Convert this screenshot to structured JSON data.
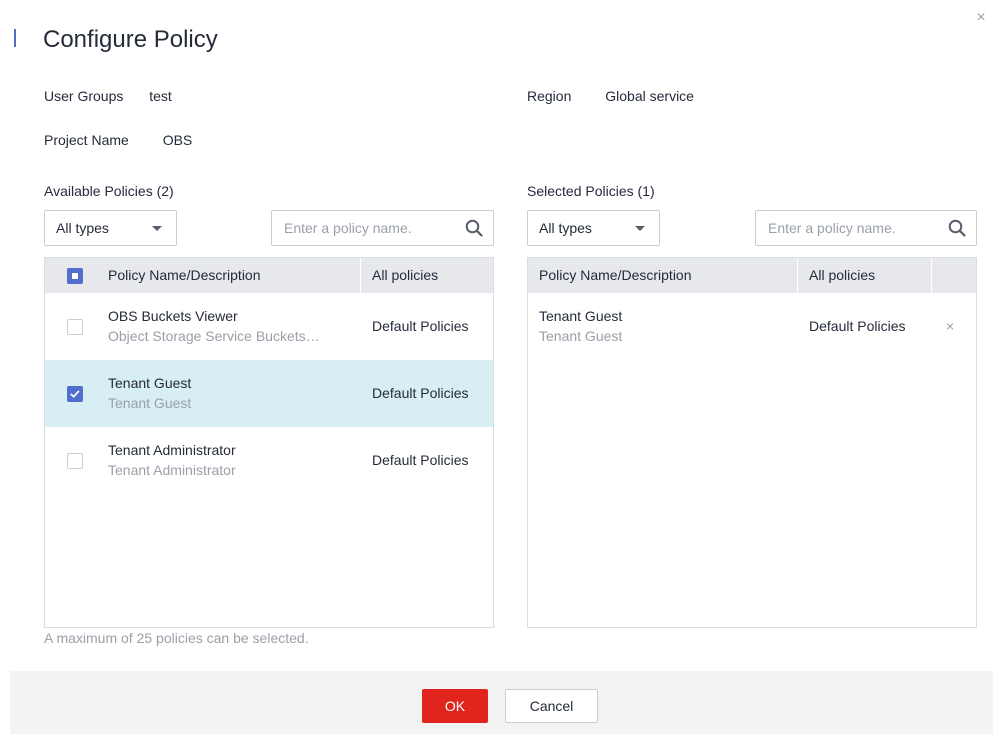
{
  "dialog": {
    "title": "Configure Policy",
    "close_glyph": "×"
  },
  "info": {
    "user_groups_label": "User Groups",
    "user_groups_value": "test",
    "region_label": "Region",
    "region_value": "Global service",
    "project_label": "Project Name",
    "project_value": "OBS"
  },
  "available": {
    "title": "Available Policies (2)",
    "filter": {
      "selected": "All types"
    },
    "search": {
      "placeholder": "Enter a policy name."
    },
    "header": {
      "col_name": "Policy Name/Description",
      "col_type": "All policies",
      "select_all_state": "partial"
    },
    "rows": [
      {
        "name": "OBS Buckets Viewer",
        "desc": "Object Storage Service Buckets…",
        "type": "Default Policies",
        "checked": false
      },
      {
        "name": "Tenant Guest",
        "desc": "Tenant Guest",
        "type": "Default Policies",
        "checked": true
      },
      {
        "name": "Tenant Administrator",
        "desc": "Tenant Administrator",
        "type": "Default Policies",
        "checked": false
      }
    ],
    "hint": "A maximum of 25 policies can be selected."
  },
  "selected": {
    "title": "Selected Policies (1)",
    "filter": {
      "selected": "All types"
    },
    "search": {
      "placeholder": "Enter a policy name."
    },
    "header": {
      "col_name": "Policy Name/Description",
      "col_type": "All policies"
    },
    "rows": [
      {
        "name": "Tenant Guest",
        "desc": "Tenant Guest",
        "type": "Default Policies",
        "remove_glyph": "×"
      }
    ]
  },
  "footer": {
    "ok_label": "OK",
    "cancel_label": "Cancel"
  },
  "icons": {
    "search": "search-icon",
    "caret": "chevron-down-icon",
    "check": "check-icon",
    "close": "close-icon"
  },
  "colors": {
    "accent": "#526ecc",
    "primary_button": "#e0251f",
    "selected_row": "#d7eef3",
    "header_bg": "#e6e8ec",
    "muted_text": "#9aa0a8"
  }
}
